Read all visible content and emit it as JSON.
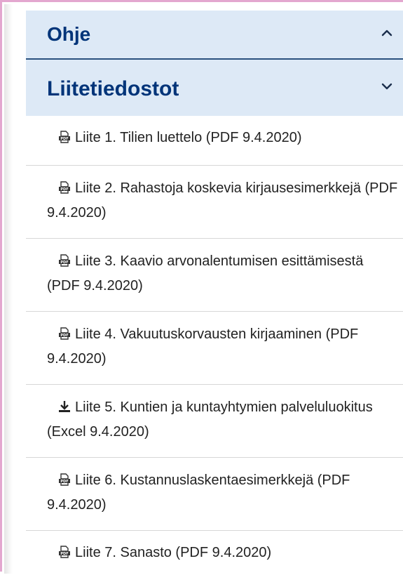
{
  "accordion": {
    "ohje": {
      "title": "Ohje",
      "icon": "chevron-up-icon"
    },
    "liitetiedostot": {
      "title": "Liitetiedostot",
      "icon": "chevron-down-icon"
    }
  },
  "attachments": [
    {
      "icon": "pdf-icon",
      "label": "Liite 1. Tilien luettelo (PDF 9.4.2020)"
    },
    {
      "icon": "pdf-icon",
      "label": "Liite 2. Rahastoja koskevia kirjausesimerkkejä (PDF 9.4.2020)"
    },
    {
      "icon": "pdf-icon",
      "label": "Liite 3. Kaavio arvonalentumisen esittämisestä (PDF 9.4.2020)"
    },
    {
      "icon": "pdf-icon",
      "label": "Liite 4. Vakuutuskorvausten kirjaaminen (PDF 9.4.2020)"
    },
    {
      "icon": "download-icon",
      "label": "Liite 5. Kuntien ja kuntayhtymien palveluluokitus (Excel 9.4.2020)"
    },
    {
      "icon": "pdf-icon",
      "label": "Liite 6. Kustannuslaskentaesimerkkejä (PDF 9.4.2020)"
    },
    {
      "icon": "pdf-icon",
      "label": "Liite 7. Sanasto (PDF 9.4.2020)"
    }
  ],
  "colors": {
    "header_bg": "#dde9f6",
    "header_text": "#003479",
    "frame_border": "#e3a7cf"
  }
}
